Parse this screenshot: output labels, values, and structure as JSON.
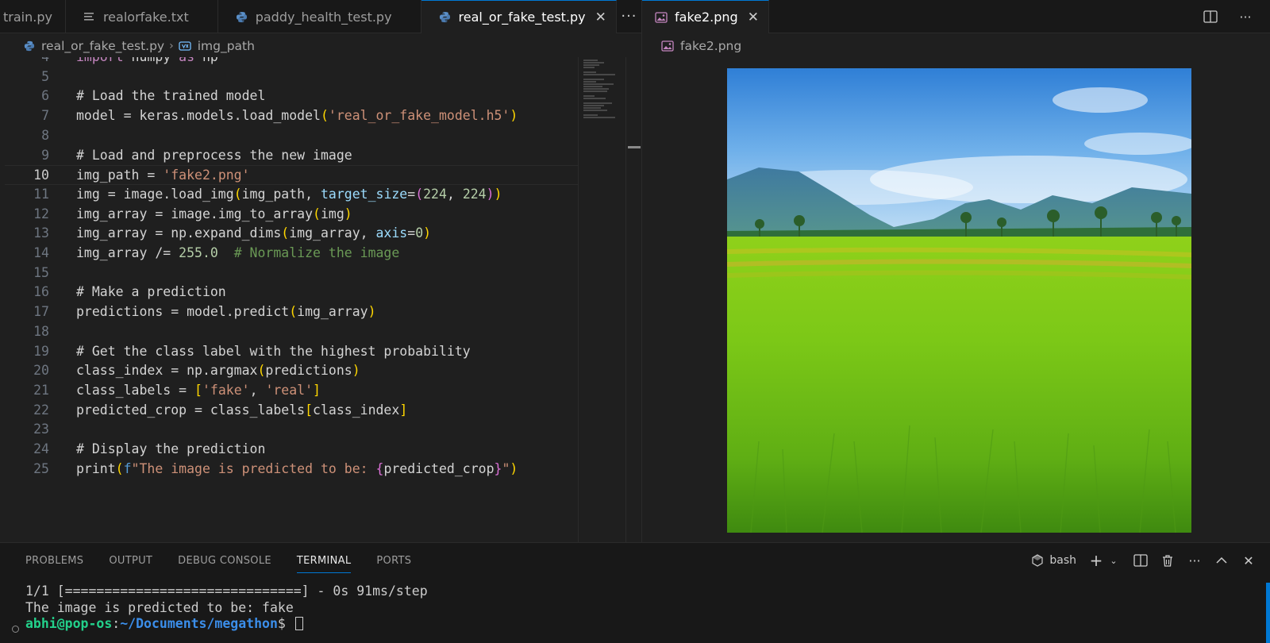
{
  "left_group": {
    "tabs": [
      {
        "label": "train.py",
        "icon": "python-icon",
        "active": false
      },
      {
        "label": "realorfake.txt",
        "icon": "text-file-icon",
        "active": false
      },
      {
        "label": "paddy_health_test.py",
        "icon": "python-icon",
        "active": false
      },
      {
        "label": "real_or_fake_test.py",
        "icon": "python-icon",
        "active": true
      }
    ],
    "more_label": "···",
    "breadcrumb": {
      "file": "real_or_fake_test.py",
      "symbol": "img_path"
    }
  },
  "code": {
    "current_line": "10",
    "lines": [
      {
        "n": "4",
        "text": "import numpy as np"
      },
      {
        "n": "5",
        "text": ""
      },
      {
        "n": "6",
        "text": "# Load the trained model"
      },
      {
        "n": "7",
        "text": "model = keras.models.load_model('real_or_fake_model.h5')"
      },
      {
        "n": "8",
        "text": ""
      },
      {
        "n": "9",
        "text": "# Load and preprocess the new image"
      },
      {
        "n": "10",
        "text": "img_path = 'fake2.png'"
      },
      {
        "n": "11",
        "text": "img = image.load_img(img_path, target_size=(224, 224))"
      },
      {
        "n": "12",
        "text": "img_array = image.img_to_array(img)"
      },
      {
        "n": "13",
        "text": "img_array = np.expand_dims(img_array, axis=0)"
      },
      {
        "n": "14",
        "text": "img_array /= 255.0  # Normalize the image"
      },
      {
        "n": "15",
        "text": ""
      },
      {
        "n": "16",
        "text": "# Make a prediction"
      },
      {
        "n": "17",
        "text": "predictions = model.predict(img_array)"
      },
      {
        "n": "18",
        "text": ""
      },
      {
        "n": "19",
        "text": "# Get the class label with the highest probability"
      },
      {
        "n": "20",
        "text": "class_index = np.argmax(predictions)"
      },
      {
        "n": "21",
        "text": "class_labels = ['fake', 'real']"
      },
      {
        "n": "22",
        "text": "predicted_crop = class_labels[class_index]"
      },
      {
        "n": "23",
        "text": ""
      },
      {
        "n": "24",
        "text": "# Display the prediction"
      },
      {
        "n": "25",
        "text": "print(f\"The image is predicted to be: {predicted_crop}\")"
      }
    ]
  },
  "right_group": {
    "tab": {
      "label": "fake2.png",
      "icon": "image-file-icon"
    },
    "breadcrumb": "fake2.png",
    "actions": [
      "split-editor-icon",
      "more-actions-icon"
    ],
    "image": {
      "alt": "rice paddy field with mountains"
    }
  },
  "panel": {
    "tabs": [
      {
        "label": "PROBLEMS",
        "active": false
      },
      {
        "label": "OUTPUT",
        "active": false
      },
      {
        "label": "DEBUG CONSOLE",
        "active": false
      },
      {
        "label": "TERMINAL",
        "active": true
      },
      {
        "label": "PORTS",
        "active": false
      }
    ],
    "shell_label": "bash",
    "terminal": {
      "line1": "1/1 [==============================] - 0s 91ms/step",
      "line2": "The image is predicted to be: fake",
      "prompt_user": "abhi@pop-os",
      "prompt_sep": ":",
      "prompt_path": "~/Documents/megathon",
      "prompt_end": "$ "
    }
  },
  "colors": {
    "accent": "#0078d4",
    "comment": "#6a9955",
    "string": "#ce9178",
    "number": "#b5cea8",
    "bracket": "#ffd700",
    "param": "#9cdcfe"
  }
}
